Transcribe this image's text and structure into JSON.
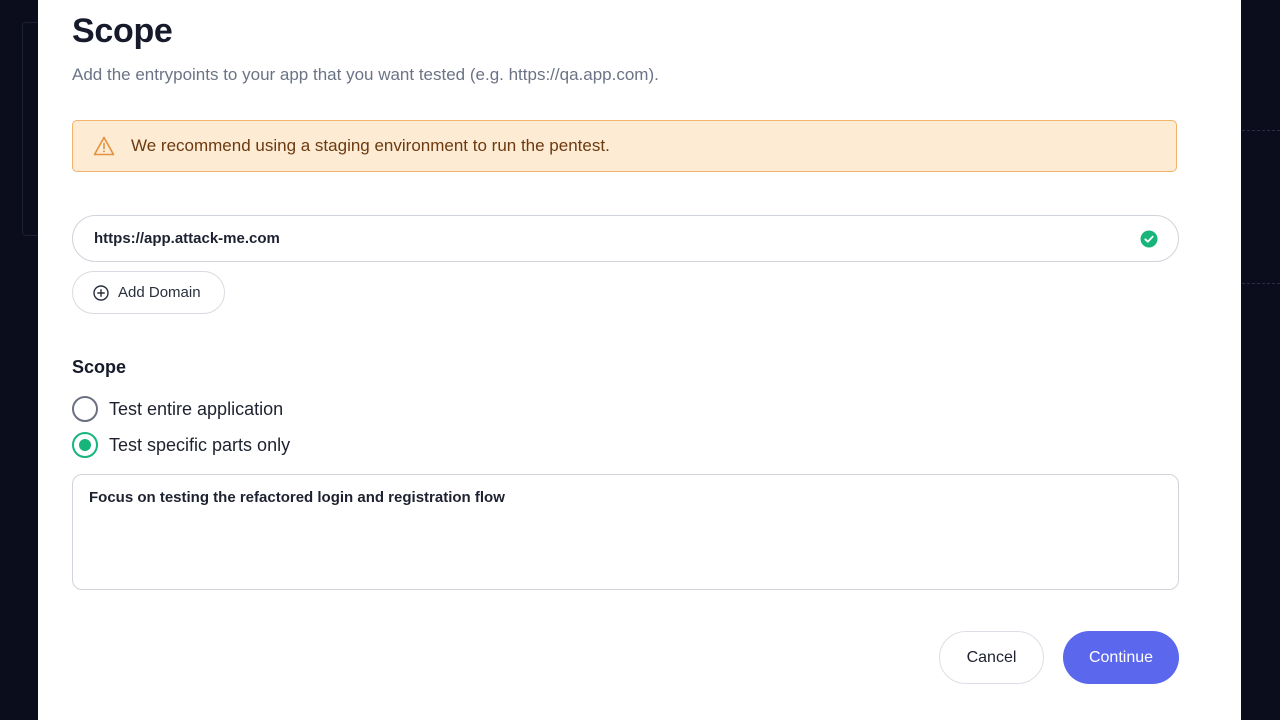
{
  "dialog": {
    "title": "Scope",
    "subtitle": "Add the entrypoints to your app that you want tested (e.g. https://qa.app.com).",
    "alert": {
      "icon": "warning-icon",
      "text": "We recommend using a staging environment to run the pentest."
    },
    "domain": {
      "value": "https://app.attack-me.com",
      "status_icon": "check-circle-icon"
    },
    "add_domain_label": "Add Domain",
    "scope": {
      "heading": "Scope",
      "options": [
        {
          "label": "Test entire application",
          "selected": false
        },
        {
          "label": "Test specific parts only",
          "selected": true
        }
      ],
      "details": "Focus on testing the refactored login and registration flow"
    },
    "buttons": {
      "cancel": "Cancel",
      "continue": "Continue"
    }
  },
  "colors": {
    "accent": "#5b67ec",
    "success": "#18b57b",
    "warning_bg": "#fdebd4",
    "warning_border": "#f2b36c",
    "backdrop": "#0b0d1c"
  }
}
